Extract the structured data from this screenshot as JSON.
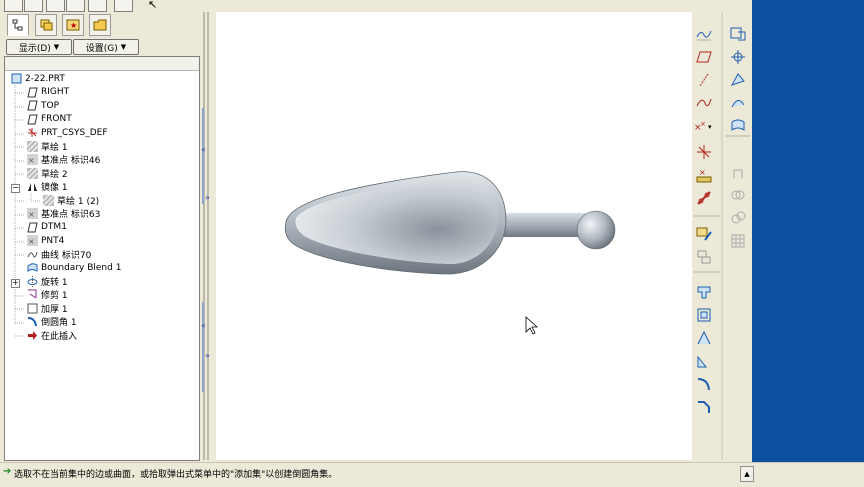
{
  "toolbar_top": {
    "tabs": [
      "model-tree-tab",
      "layer-tab",
      "favorites-tab",
      "folder-tab"
    ],
    "display_label": "显示(D)",
    "settings_label": "设置(G)"
  },
  "model_tree": {
    "items": [
      {
        "label": "2-22.PRT",
        "icon": "part-icon"
      },
      {
        "label": "RIGHT",
        "icon": "datum-plane-icon"
      },
      {
        "label": "TOP",
        "icon": "datum-plane-icon"
      },
      {
        "label": "FRONT",
        "icon": "datum-plane-icon"
      },
      {
        "label": "PRT_CSYS_DEF",
        "icon": "csys-icon"
      },
      {
        "label": "草绘 1",
        "icon": "sketch-icon"
      },
      {
        "label": "基准点 标识46",
        "icon": "datum-point-icon"
      },
      {
        "label": "草绘 2",
        "icon": "sketch-icon"
      },
      {
        "label": "镜像 1",
        "icon": "mirror-icon"
      },
      {
        "label": "草绘 1 (2)",
        "icon": "sketch-icon"
      },
      {
        "label": "基准点 标识63",
        "icon": "datum-point-icon"
      },
      {
        "label": "DTM1",
        "icon": "datum-plane-icon"
      },
      {
        "label": "PNT4",
        "icon": "datum-point-icon"
      },
      {
        "label": "曲线 标识70",
        "icon": "curve-icon"
      },
      {
        "label": "Boundary Blend 1",
        "icon": "boundary-blend-icon"
      },
      {
        "label": "旋转 1",
        "icon": "revolve-icon"
      },
      {
        "label": "修剪 1",
        "icon": "trim-icon"
      },
      {
        "label": "加厚 1",
        "icon": "thicken-icon"
      },
      {
        "label": "倒圆角 1",
        "icon": "round-icon"
      },
      {
        "label": "在此插入",
        "icon": "insert-here-icon"
      }
    ]
  },
  "status": {
    "message": "选取不在当前集中的边或曲面，或拾取弹出式菜单中的\"添加集\"以创建倒圆角集。"
  },
  "colors": {
    "chrome": "#ece9d8",
    "desktop_blue": "#0b4fa0",
    "model_gray": "#a9b3bd",
    "status_arrow": "#1f8a1f"
  }
}
